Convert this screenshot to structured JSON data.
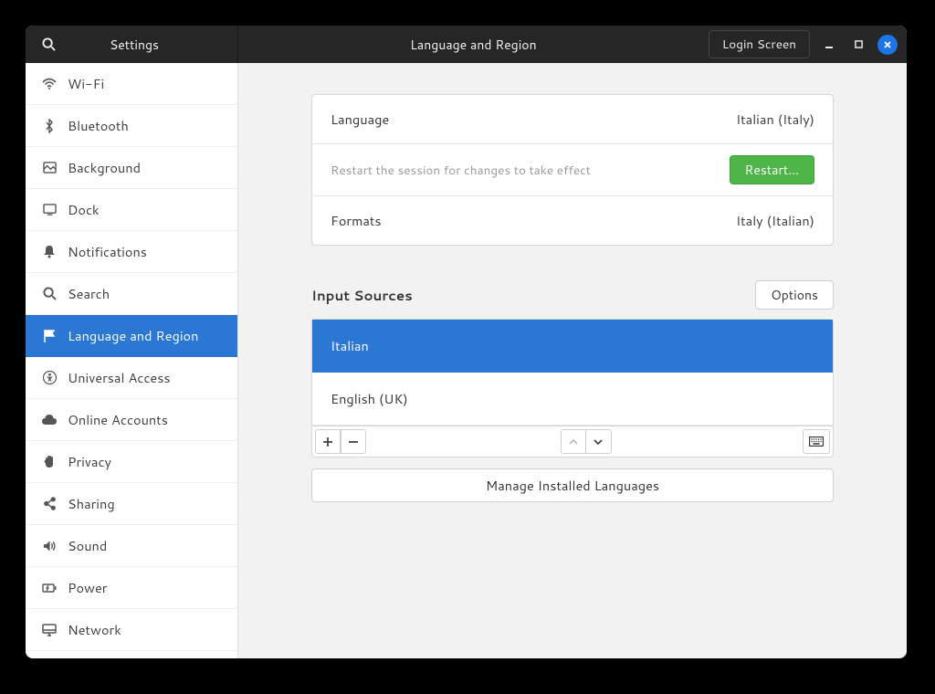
{
  "header": {
    "sidebar_title": "Settings",
    "main_title": "Language and Region",
    "login_screen": "Login Screen"
  },
  "sidebar": {
    "items": [
      {
        "icon": "wifi-icon",
        "label": "Wi-Fi"
      },
      {
        "icon": "bluetooth-icon",
        "label": "Bluetooth"
      },
      {
        "icon": "background-icon",
        "label": "Background"
      },
      {
        "icon": "dock-icon",
        "label": "Dock"
      },
      {
        "icon": "notifications-icon",
        "label": "Notifications"
      },
      {
        "icon": "search-icon",
        "label": "Search"
      },
      {
        "icon": "flag-icon",
        "label": "Language and Region",
        "selected": true
      },
      {
        "icon": "accessibility-icon",
        "label": "Universal Access"
      },
      {
        "icon": "cloud-icon",
        "label": "Online Accounts"
      },
      {
        "icon": "hand-icon",
        "label": "Privacy"
      },
      {
        "icon": "share-icon",
        "label": "Sharing"
      },
      {
        "icon": "sound-icon",
        "label": "Sound"
      },
      {
        "icon": "power-icon",
        "label": "Power"
      },
      {
        "icon": "network-icon",
        "label": "Network"
      }
    ]
  },
  "main": {
    "language_label": "Language",
    "language_value": "Italian (Italy)",
    "restart_text": "Restart the session for changes to take effect",
    "restart_button": "Restart…",
    "formats_label": "Formats",
    "formats_value": "Italy (Italian)",
    "input_sources_title": "Input Sources",
    "options_button": "Options",
    "input_sources": [
      {
        "label": "Italian",
        "selected": true
      },
      {
        "label": "English (UK)"
      }
    ],
    "manage_button": "Manage Installed Languages"
  }
}
